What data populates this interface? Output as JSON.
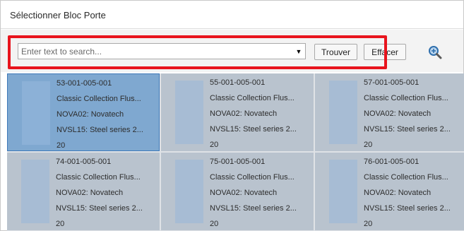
{
  "window": {
    "title": "Sélectionner Bloc Porte"
  },
  "search": {
    "placeholder": "Enter text to search...",
    "value": ""
  },
  "toolbar": {
    "find_label": "Trouver",
    "clear_label": "Effacer",
    "zoom_icon": "zoom-in-icon"
  },
  "colors": {
    "highlight": "#e8141d",
    "card": "#b9c3ce",
    "card_selected": "#7fa8d0",
    "thumb": "#a7bcd4"
  },
  "cards": [
    {
      "code": "53-001-005-001",
      "collection": "Classic Collection Flus...",
      "model": "NOVA02: Novatech",
      "series": "NVSL15: Steel series 2...",
      "qty": "20",
      "selected": true
    },
    {
      "code": "55-001-005-001",
      "collection": "Classic Collection Flus...",
      "model": "NOVA02: Novatech",
      "series": "NVSL15: Steel series 2...",
      "qty": "20",
      "selected": false
    },
    {
      "code": "57-001-005-001",
      "collection": "Classic Collection Flus...",
      "model": "NOVA02: Novatech",
      "series": "NVSL15: Steel series 2...",
      "qty": "20",
      "selected": false
    },
    {
      "code": "74-001-005-001",
      "collection": "Classic Collection Flus...",
      "model": "NOVA02: Novatech",
      "series": "NVSL15: Steel series 2...",
      "qty": "20",
      "selected": false
    },
    {
      "code": "75-001-005-001",
      "collection": "Classic Collection Flus...",
      "model": "NOVA02: Novatech",
      "series": "NVSL15: Steel series 2...",
      "qty": "20",
      "selected": false
    },
    {
      "code": "76-001-005-001",
      "collection": "Classic Collection Flus...",
      "model": "NOVA02: Novatech",
      "series": "NVSL15: Steel series 2...",
      "qty": "20",
      "selected": false
    }
  ]
}
